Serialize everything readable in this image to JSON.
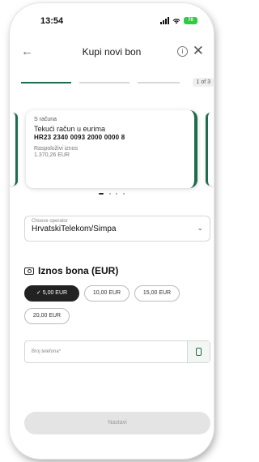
{
  "status_bar": {
    "time": "13:54",
    "battery": "70"
  },
  "header": {
    "title": "Kupi novi bon",
    "back_icon": "arrow-left-icon",
    "info_icon": "info-icon",
    "close_icon": "close-icon"
  },
  "progress": {
    "step_label": "1 of 3",
    "current_step": 1,
    "total_steps": 3
  },
  "account_card": {
    "from_label": "S računa",
    "account_name": "Tekući račun u eurima",
    "iban": "HR23 2340 0093 2000 0000 8",
    "available_label": "Raspoloživi iznos",
    "available_value": "1.370,26 EUR"
  },
  "carousel": {
    "pages": 4,
    "active": 0
  },
  "operator": {
    "label": "Choose operator",
    "value": "HrvatskiTelekom/Simpa"
  },
  "amount_section": {
    "title": "Iznos bona (EUR)",
    "icon": "cash-icon"
  },
  "amounts": [
    {
      "label": "5,00 EUR",
      "selected": true
    },
    {
      "label": "10,00 EUR",
      "selected": false
    },
    {
      "label": "15,00 EUR",
      "selected": false
    },
    {
      "label": "20,00 EUR",
      "selected": false
    }
  ],
  "phone": {
    "placeholder": "Broj telefona*",
    "contact_icon": "phone-contact-icon"
  },
  "submit": {
    "label": "Nastavi"
  },
  "colors": {
    "accent": "#1f6b4e",
    "selected_pill": "#222222",
    "button_disabled": "#e4e4e4"
  }
}
